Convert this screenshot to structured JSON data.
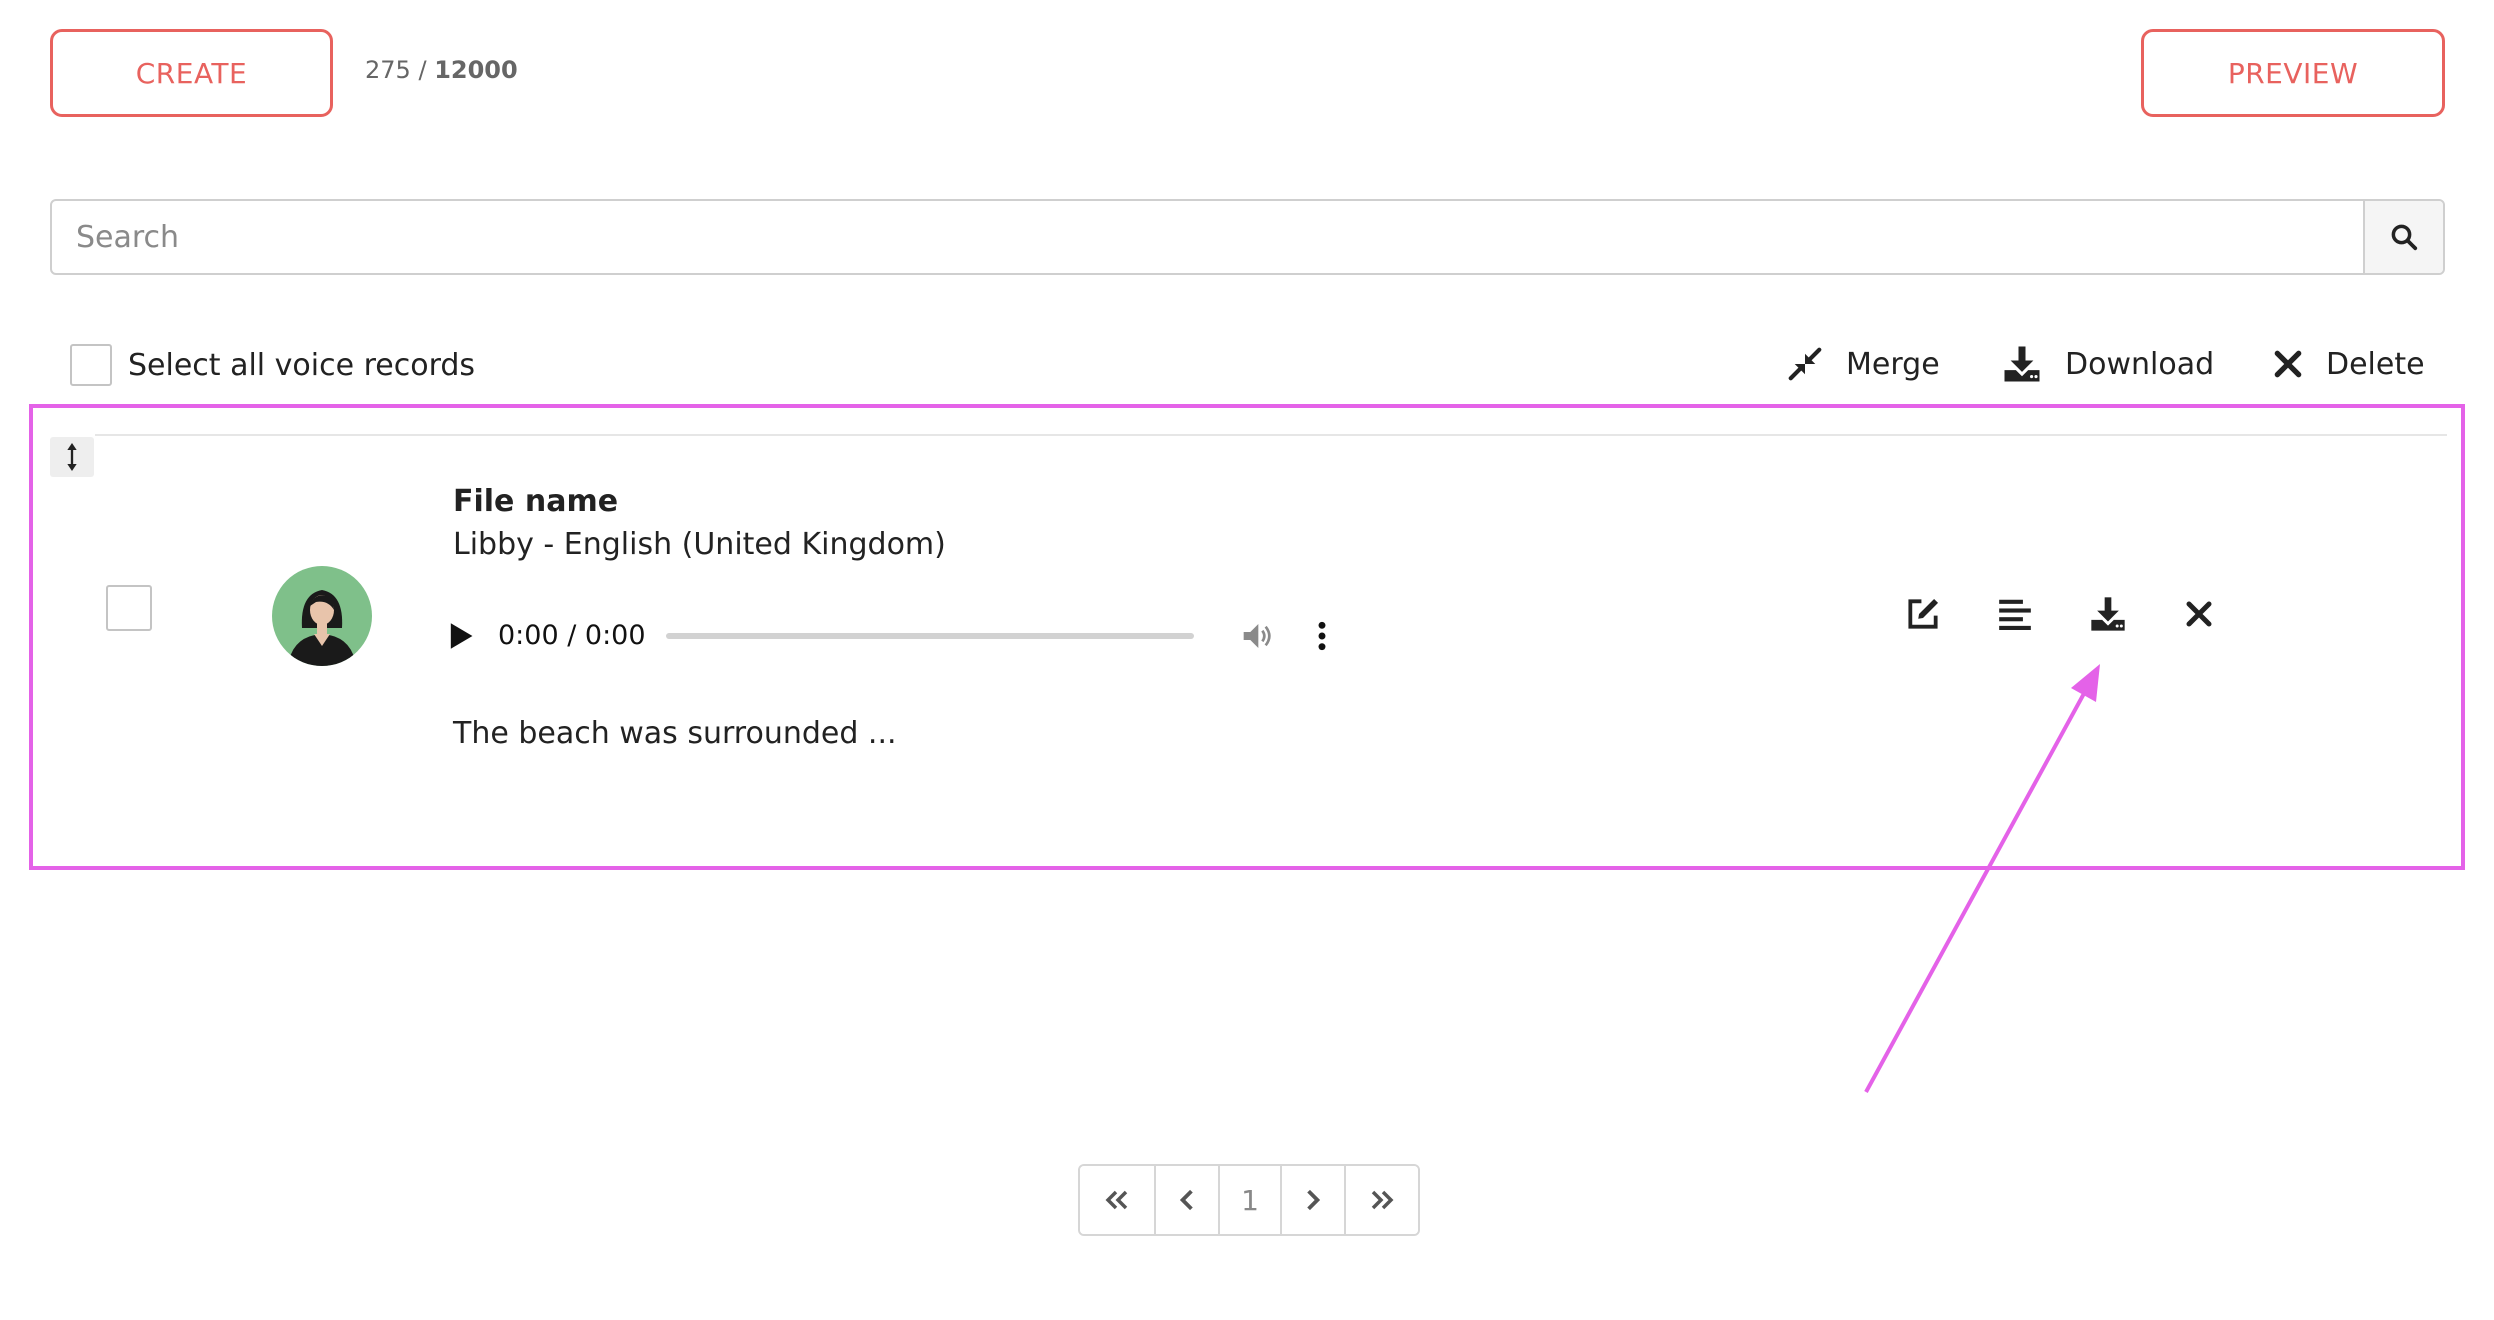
{
  "header": {
    "create_label": "CREATE",
    "preview_label": "PREVIEW",
    "counter_used": "275",
    "counter_separator": "/",
    "counter_total": "12000"
  },
  "search": {
    "placeholder": "Search",
    "icon": "search-icon"
  },
  "toolbar": {
    "select_all_label": "Select all voice records",
    "merge_label": "Merge",
    "download_label": "Download",
    "delete_label": "Delete"
  },
  "record": {
    "title": "File name",
    "voice": "Libby - English (United Kingdom)",
    "time": "0:00 / 0:00",
    "preview_text": "The beach was surrounded ...",
    "actions": [
      "edit-icon",
      "text-align-icon",
      "download-icon",
      "close-icon"
    ]
  },
  "pagination": {
    "current_page": "1"
  },
  "colors": {
    "accent": "#e8625e",
    "annotation": "#e462e8",
    "avatar_bg": "#7fc08a"
  }
}
